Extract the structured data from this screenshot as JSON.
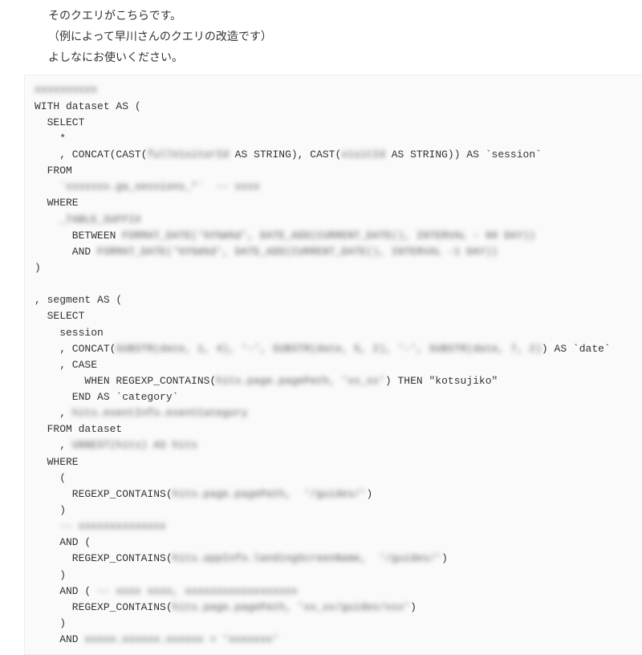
{
  "prose": {
    "line1": "そのクエリがこちらです。",
    "line2": "（例によって早川さんのクエリの改造です）",
    "line3": "よしなにお使いください。"
  },
  "code": {
    "l00_blur": "xxxxxxxxxx",
    "l01": "WITH dataset AS (",
    "l02": "  SELECT",
    "l03": "    *",
    "l04a": "    , CONCAT(CAST(",
    "l04b_blur": "fullVisitorId",
    "l04c": " AS STRING), CAST(",
    "l04d_blur": "visitId",
    "l04e": " AS STRING)) AS `session`",
    "l05": "  FROM",
    "l06_blur": "    `xxxxxxx.ga_sessions_*`  -- xxxx",
    "l07": "  WHERE",
    "l08_blur": "    _TABLE_SUFFIX",
    "l09a": "      BETWEEN ",
    "l09b_blur": "FORMAT_DATE('%Y%m%d', DATE_ADD(CURRENT_DATE(), INTERVAL - 90 DAY))",
    "l10a": "      AND ",
    "l10b_blur": "FORMAT_DATE('%Y%m%d', DATE_ADD(CURRENT_DATE(), INTERVAL -1 DAY))",
    "l11": ")",
    "l12": "",
    "l13": ", segment AS (",
    "l14": "  SELECT",
    "l15": "    session",
    "l16a": "    , CONCAT(",
    "l16b_blur": "SUBSTR(date, 1, 4), '-', SUBSTR(date, 5, 2), '-', SUBSTR(date, 7, 2)",
    "l16c": ") AS `date`",
    "l17": "    , CASE",
    "l18a": "        WHEN REGEXP_CONTAINS(",
    "l18b_blur": "hits.page.pagePath, 'xx_xx'",
    "l18c": ") THEN \"kotsujiko\"",
    "l19": "      END AS `category`",
    "l20a": "    , ",
    "l20b_blur": "hits.eventInfo.eventCategory",
    "l21": "  FROM dataset",
    "l22a": "    , ",
    "l22b_blur": "UNNEST(hits) AS hits",
    "l23": "  WHERE",
    "l24": "    (",
    "l25a": "      REGEXP_CONTAINS(",
    "l25b_blur": "hits.page.pagePath,  '/guides/'",
    "l25c": ")",
    "l26": "    )",
    "l27a": "    ",
    "l27b_blur": "-- xxxxxxxxxxxxxx",
    "l28": "    AND (",
    "l29a": "      REGEXP_CONTAINS(",
    "l29b_blur": "hits.appInfo.landingScreenName,  '/guides/'",
    "l29c": ")",
    "l30": "    )",
    "l31a": "    AND ( ",
    "l31b_blur": "-- xxxx xxxx, xxxxxxxxxxxxxxxxxx",
    "l32a": "      REGEXP_CONTAINS(",
    "l32b_blur": "hits.page.pagePath, 'xx_xx/guides/xxx'",
    "l32c": ")",
    "l33": "    )",
    "l34a": "    AND ",
    "l34b_blur": "xxxxx.xxxxxx.xxxxxx = 'xxxxxxx'"
  }
}
